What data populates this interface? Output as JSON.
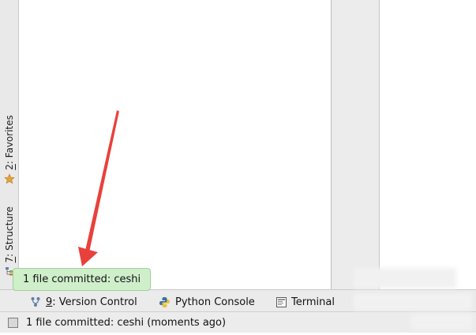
{
  "left_strip": {
    "tabs": [
      {
        "mnemonic": "2",
        "label": ": Favorites",
        "icon": "star-icon"
      },
      {
        "mnemonic": "7",
        "label": ": Structure",
        "icon": "structure-icon"
      }
    ]
  },
  "bottom_bar": {
    "tabs": [
      {
        "mnemonic": "9",
        "label": ": Version Control",
        "icon": "version-control-icon"
      },
      {
        "mnemonic": "",
        "label": "Python Console",
        "icon": "python-icon"
      },
      {
        "mnemonic": "",
        "label": "Terminal",
        "icon": "terminal-icon"
      }
    ]
  },
  "notification": {
    "message": "1 file committed: ceshi"
  },
  "status_bar": {
    "message": "1 file committed: ceshi (moments ago)"
  },
  "colors": {
    "arrow": "#e8413c",
    "balloon_bg": "#cfefcb",
    "star": "#e6a23a"
  }
}
